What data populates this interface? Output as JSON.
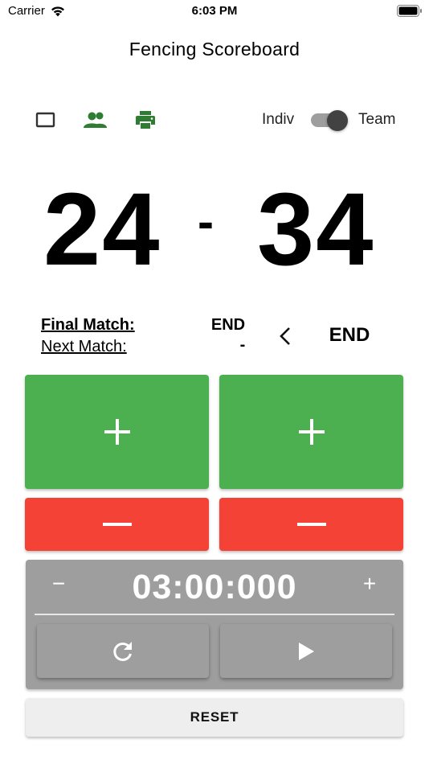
{
  "status_bar": {
    "carrier": "Carrier",
    "time": "6:03 PM",
    "wifi_icon": "wifi-icon",
    "battery_icon": "battery-icon"
  },
  "header": {
    "title": "Fencing Scoreboard"
  },
  "toolbar": {
    "icons": [
      "tablet-icon",
      "people-icon",
      "print-icon"
    ],
    "mode_left": "Indiv",
    "mode_right": "Team",
    "mode_selected": "Team"
  },
  "score": {
    "left": "24",
    "separator": "-",
    "right": "34"
  },
  "match": {
    "final_label": "Final Match:",
    "final_value": "END",
    "next_label": "Next Match:",
    "next_value": "-",
    "current": "END",
    "back_icon": "chevron-left-icon"
  },
  "controls": {
    "plus_symbol": "+",
    "minus_icon": "minus-icon"
  },
  "timer": {
    "decrease": "−",
    "value": "03:00:000",
    "increase": "+",
    "restart_icon": "refresh-icon",
    "play_icon": "play-icon"
  },
  "reset": {
    "label": "RESET"
  },
  "colors": {
    "green": "#4caf50",
    "red": "#f44336",
    "timer_gray": "#9e9e9e",
    "accent_green": "#2e7d32"
  }
}
